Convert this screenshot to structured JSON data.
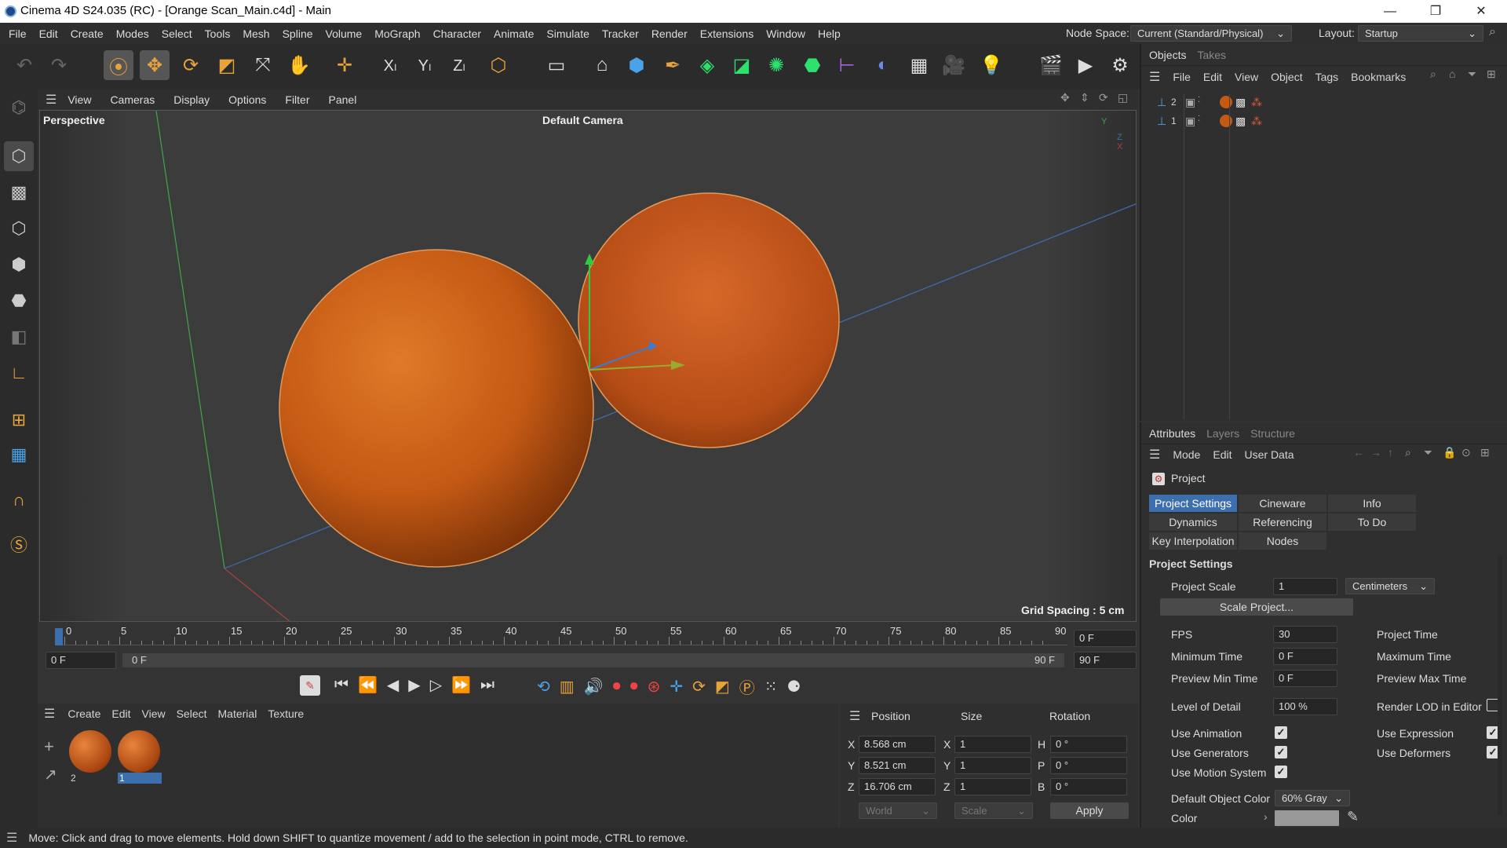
{
  "window": {
    "title": "Cinema 4D S24.035 (RC) - [Orange Scan_Main.c4d] - Main",
    "minimize": "—",
    "restore": "❐",
    "close": "✕"
  },
  "menu": [
    "File",
    "Edit",
    "Create",
    "Modes",
    "Select",
    "Tools",
    "Mesh",
    "Spline",
    "Volume",
    "MoGraph",
    "Character",
    "Animate",
    "Simulate",
    "Tracker",
    "Render",
    "Extensions",
    "Window",
    "Help"
  ],
  "nodespace": {
    "label": "Node Space:",
    "value": "Current (Standard/Physical)"
  },
  "layout": {
    "label": "Layout:",
    "value": "Startup"
  },
  "viewport": {
    "menu": [
      "View",
      "Cameras",
      "Display",
      "Options",
      "Filter",
      "Panel"
    ],
    "name": "Perspective",
    "camera": "Default Camera",
    "grid_spacing": "Grid Spacing : 5 cm",
    "axis_labels": {
      "y": "Y",
      "z": "Z",
      "x": "X"
    }
  },
  "timeline": {
    "ticks": [
      "0",
      "5",
      "10",
      "15",
      "20",
      "25",
      "30",
      "35",
      "40",
      "45",
      "50",
      "55",
      "60",
      "65",
      "70",
      "75",
      "80",
      "85",
      "90"
    ],
    "current_frame": "0 F",
    "start": "0 F",
    "range_start": "0 F",
    "range_end": "90 F",
    "end": "90 F"
  },
  "material_manager": {
    "menu": [
      "Create",
      "Edit",
      "View",
      "Select",
      "Material",
      "Texture"
    ],
    "materials": [
      {
        "name": "2"
      },
      {
        "name": "1"
      }
    ]
  },
  "coordinates": {
    "headers": [
      "Position",
      "Size",
      "Rotation"
    ],
    "rows": [
      {
        "axis": "X",
        "pos": "8.568 cm",
        "size_axis": "X",
        "size": "1",
        "rot_axis": "H",
        "rot": "0 °"
      },
      {
        "axis": "Y",
        "pos": "8.521 cm",
        "size_axis": "Y",
        "size": "1",
        "rot_axis": "P",
        "rot": "0 °"
      },
      {
        "axis": "Z",
        "pos": "16.706 cm",
        "size_axis": "Z",
        "size": "1",
        "rot_axis": "B",
        "rot": "0 °"
      }
    ],
    "space": "World",
    "mode": "Scale",
    "apply": "Apply"
  },
  "objects_panel": {
    "tabs": [
      "Objects",
      "Takes"
    ],
    "menu": [
      "File",
      "Edit",
      "View",
      "Object",
      "Tags",
      "Bookmarks"
    ],
    "items": [
      {
        "name": "2"
      },
      {
        "name": "1"
      }
    ]
  },
  "attributes": {
    "tabs": [
      "Attributes",
      "Layers",
      "Structure"
    ],
    "menu": [
      "Mode",
      "Edit",
      "User Data"
    ],
    "object": "Project",
    "section_tabs": [
      "Project Settings",
      "Cineware",
      "Info",
      "Dynamics",
      "Referencing",
      "To Do",
      "Key Interpolation",
      "Nodes"
    ],
    "section_title": "Project Settings",
    "project_scale_label": "Project Scale",
    "project_scale": "1",
    "project_scale_unit": "Centimeters",
    "scale_project": "Scale Project...",
    "fps_label": "FPS",
    "fps": "30",
    "project_time_label": "Project Time",
    "min_time_label": "Minimum Time",
    "min_time": "0 F",
    "max_time_label": "Maximum Time",
    "preview_min_label": "Preview Min Time",
    "preview_min": "0 F",
    "preview_max_label": "Preview Max Time",
    "lod_label": "Level of Detail",
    "lod": "100 %",
    "render_lod_label": "Render LOD in Editor",
    "use_animation": "Use Animation",
    "use_expression": "Use Expression",
    "use_generators": "Use Generators",
    "use_deformers": "Use Deformers",
    "use_motion": "Use Motion System",
    "default_color_label": "Default Object Color",
    "default_color": "60% Gray",
    "color_label": "Color"
  },
  "status": "Move: Click and drag to move elements. Hold down SHIFT to quantize movement / add to the selection in point mode, CTRL to remove.",
  "colors": {
    "accent": "#3e6fad",
    "orange": "#d4651c",
    "background": "#333333"
  }
}
